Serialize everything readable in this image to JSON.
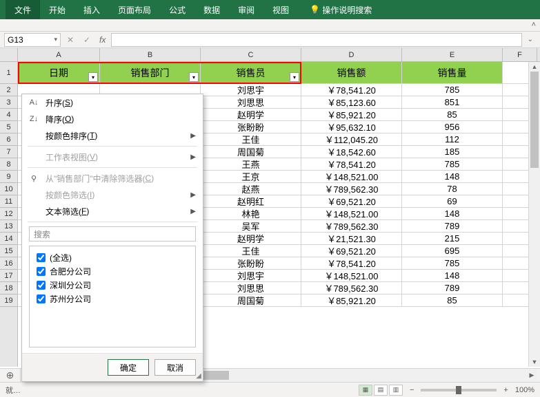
{
  "ribbon": {
    "file": "文件",
    "home": "开始",
    "insert": "插入",
    "layout": "页面布局",
    "formula": "公式",
    "data": "数据",
    "review": "审阅",
    "view": "视图",
    "help": "操作说明搜索"
  },
  "namebox": "G13",
  "fx": "fx",
  "cols": {
    "a_w": 119,
    "b_w": 146,
    "c_w": 146,
    "d_w": 146,
    "e_w": 146,
    "f_w": 50
  },
  "headers": {
    "A": "A",
    "B": "B",
    "C": "C",
    "D": "D",
    "E": "E",
    "F": "F"
  },
  "table_headers": {
    "date": "日期",
    "dept": "销售部门",
    "person": "销售员",
    "amount": "销售额",
    "qty": "销售量"
  },
  "rows": [
    {
      "c": "刘思宇",
      "d": "￥78,541.20",
      "e": "785"
    },
    {
      "c": "刘思思",
      "d": "￥85,123.60",
      "e": "851"
    },
    {
      "c": "赵明学",
      "d": "￥85,921.20",
      "e": "85"
    },
    {
      "c": "张盼盼",
      "d": "￥95,632.10",
      "e": "956"
    },
    {
      "c": "王佳",
      "d": "￥112,045.20",
      "e": "112"
    },
    {
      "c": "周国菊",
      "d": "￥18,542.60",
      "e": "185"
    },
    {
      "c": "王燕",
      "d": "￥78,541.20",
      "e": "785"
    },
    {
      "c": "王京",
      "d": "￥148,521.00",
      "e": "148"
    },
    {
      "c": "赵燕",
      "d": "￥789,562.30",
      "e": "78"
    },
    {
      "c": "赵明红",
      "d": "￥69,521.20",
      "e": "69"
    },
    {
      "c": "林艳",
      "d": "￥148,521.00",
      "e": "148"
    },
    {
      "c": "吴军",
      "d": "￥789,562.30",
      "e": "789"
    },
    {
      "c": "赵明学",
      "d": "￥21,521.30",
      "e": "215"
    },
    {
      "c": "王佳",
      "d": "￥69,521.20",
      "e": "695"
    },
    {
      "c": "张盼盼",
      "d": "￥78,541.20",
      "e": "785"
    },
    {
      "c": "刘思宇",
      "d": "￥148,521.00",
      "e": "148"
    },
    {
      "c": "刘思思",
      "d": "￥789,562.30",
      "e": "789"
    },
    {
      "c": "周国菊",
      "d": "￥85,921.20",
      "e": "85"
    }
  ],
  "menu": {
    "asc": "升序(",
    "asc_k": "S",
    "asc_e": ")",
    "desc": "降序(",
    "desc_k": "O",
    "desc_e": ")",
    "sortcolor": "按颜色排序(",
    "sortcolor_k": "T",
    "sortcolor_e": ")",
    "sheetview": "工作表视图(",
    "sheetview_k": "V",
    "sheetview_e": ")",
    "clear": "从\"销售部门\"中清除筛选器(",
    "clear_k": "C",
    "clear_e": ")",
    "filtercolor": "按颜色筛选(",
    "filtercolor_k": "I",
    "filtercolor_e": ")",
    "textfilter": "文本筛选(",
    "textfilter_k": "F",
    "textfilter_e": ")",
    "search": "搜索",
    "all": "(全选)",
    "opt1": "合肥分公司",
    "opt2": "深圳分公司",
    "opt3": "苏州分公司",
    "ok": "确定",
    "cancel": "取消"
  },
  "status": {
    "ready": "就…",
    "zoom": "100%"
  }
}
